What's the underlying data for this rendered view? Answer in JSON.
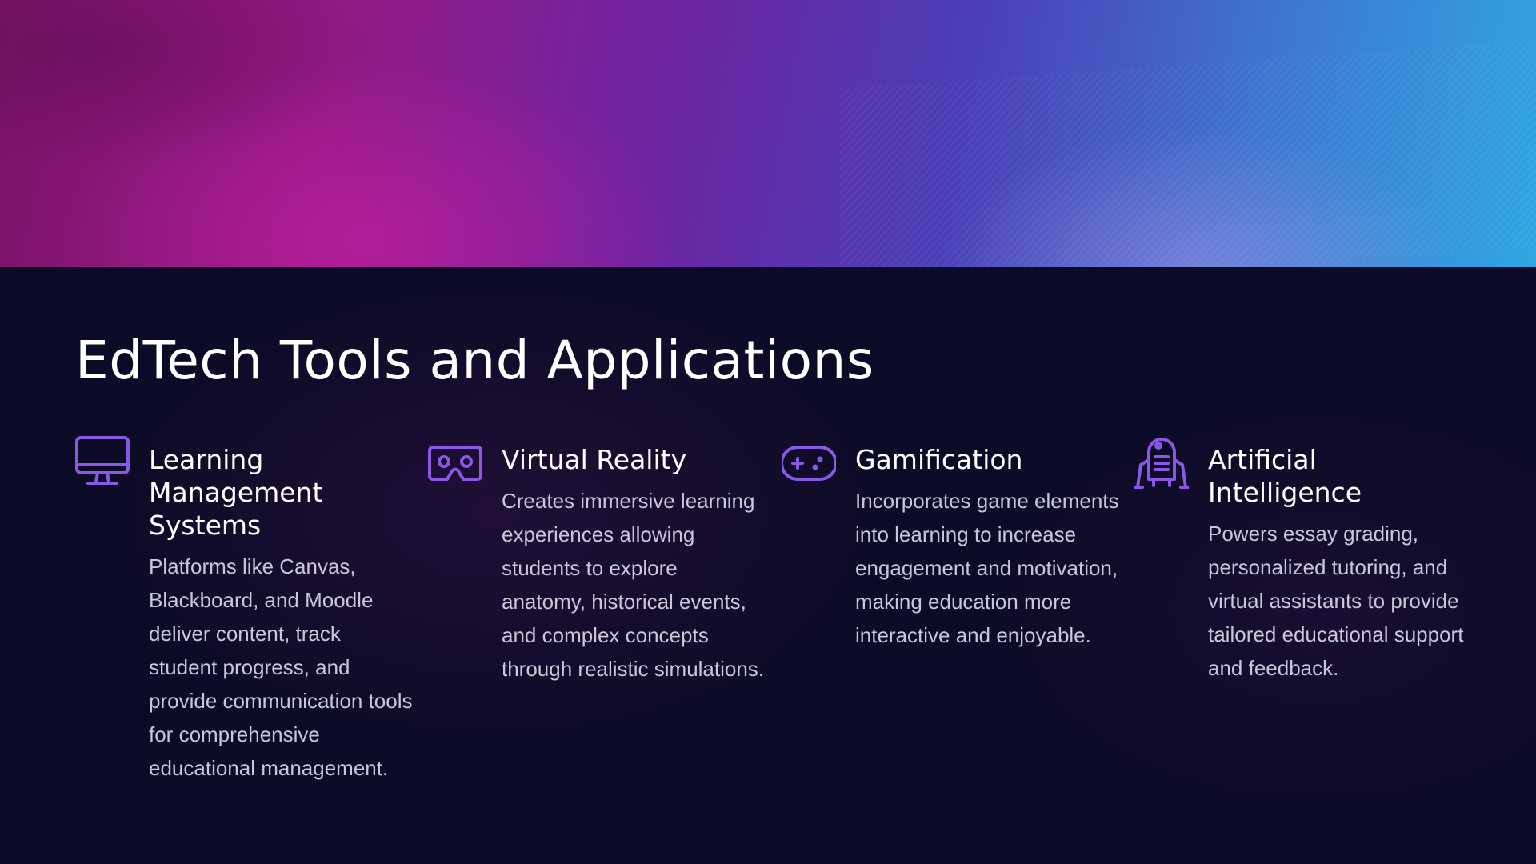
{
  "slide": {
    "title": "EdTech Tools and Applications",
    "colors": {
      "background": "#0c0b27",
      "icon_accent": "#8a57e6",
      "title_text": "#ffffff",
      "body_text": "#c8c6d8"
    },
    "cards": [
      {
        "icon": "monitor-icon",
        "title": "Learning Management Systems",
        "description": "Platforms like Canvas, Blackboard, and Moodle deliver content, track student progress, and provide communication tools for comprehensive educational management."
      },
      {
        "icon": "vr-headset-icon",
        "title": "Virtual Reality",
        "description": "Creates immersive learning experiences allowing students to explore anatomy, historical events, and complex concepts through realistic simulations."
      },
      {
        "icon": "gamepad-icon",
        "title": "Gamification",
        "description": "Incorporates game elements into learning to increase engagement and motivation, making education more interactive and enjoyable."
      },
      {
        "icon": "robot-icon",
        "title": "Artificial Intelligence",
        "description": "Powers essay grading, personalized tutoring, and virtual assistants to provide tailored educational support and feedback."
      }
    ]
  }
}
